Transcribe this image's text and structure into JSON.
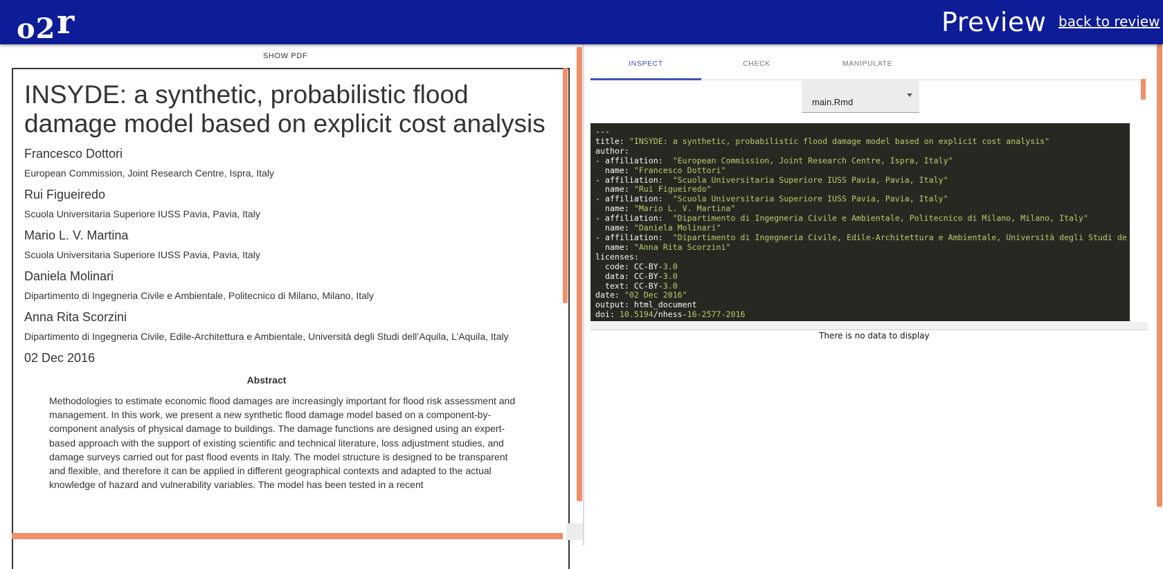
{
  "header": {
    "logo_text_o2": "o2",
    "logo_text_r": "r",
    "preview_title": "Preview",
    "back_link": "back to review"
  },
  "left": {
    "show_pdf": "SHOW PDF",
    "title": "INSYDE: a synthetic, probabilistic flood damage model based on explicit cost analysis",
    "authors": [
      {
        "name": "Francesco Dottori",
        "affiliation": "European Commission, Joint Research Centre, Ispra, Italy"
      },
      {
        "name": "Rui Figueiredo",
        "affiliation": "Scuola Universitaria Superiore IUSS Pavia, Pavia, Italy"
      },
      {
        "name": "Mario L. V. Martina",
        "affiliation": "Scuola Universitaria Superiore IUSS Pavia, Pavia, Italy"
      },
      {
        "name": "Daniela Molinari",
        "affiliation": "Dipartimento di Ingegneria Civile e Ambientale, Politecnico di Milano, Milano, Italy"
      },
      {
        "name": "Anna Rita Scorzini",
        "affiliation": "Dipartimento di Ingegneria Civile, Edile-Architettura e Ambientale, Università degli Studi dell’Aquila, L’Aquila, Italy"
      }
    ],
    "date": "02 Dec 2016",
    "abstract_title": "Abstract",
    "abstract_text": "Methodologies to estimate economic flood damages are increasingly important for flood risk assessment and management. In this work, we present a new synthetic flood damage model based on a component-by-component analysis of physical damage to buildings. The damage functions are designed using an expert-based approach with the support of existing scientific and technical literature, loss adjustment studies, and damage surveys carried out for past flood events in Italy. The model structure is designed to be transparent and flexible, and therefore it can be applied in different geographical contexts and adapted to the actual knowledge of hazard and vulnerability variables.  The model has been tested in a recent"
  },
  "right": {
    "tabs": [
      {
        "label": "INSPECT",
        "active": true
      },
      {
        "label": "CHECK",
        "active": false
      },
      {
        "label": "MANIPULATE",
        "active": false
      }
    ],
    "file_select": "main.Rmd",
    "code_lines": [
      [
        {
          "t": "---",
          "c": "k"
        }
      ],
      [
        {
          "t": "title: ",
          "c": "k"
        },
        {
          "t": "\"INSYDE: a synthetic, probabilistic flood damage model based on explicit cost analysis\"",
          "c": "s"
        }
      ],
      [
        {
          "t": "author:",
          "c": "k"
        }
      ],
      [
        {
          "t": "- affiliation:  ",
          "c": "k"
        },
        {
          "t": "\"European Commission, Joint Research Centre, Ispra, Italy\"",
          "c": "s"
        }
      ],
      [
        {
          "t": "  name: ",
          "c": "k"
        },
        {
          "t": "\"Francesco Dottori\"",
          "c": "s"
        }
      ],
      [
        {
          "t": "- affiliation:  ",
          "c": "k"
        },
        {
          "t": "\"Scuola Universitaria Superiore IUSS Pavia, Pavia, Italy\"",
          "c": "s"
        }
      ],
      [
        {
          "t": "  name: ",
          "c": "k"
        },
        {
          "t": "\"Rui Figueiredo\"",
          "c": "s"
        }
      ],
      [
        {
          "t": "- affiliation:  ",
          "c": "k"
        },
        {
          "t": "\"Scuola Universitaria Superiore IUSS Pavia, Pavia, Italy\"",
          "c": "s"
        }
      ],
      [
        {
          "t": "  name: ",
          "c": "k"
        },
        {
          "t": "\"Mario L. V. Martina\"",
          "c": "s"
        }
      ],
      [
        {
          "t": "- affiliation:  ",
          "c": "k"
        },
        {
          "t": "\"Dipartimento di Ingegneria Civile e Ambientale, Politecnico di Milano, Milano, Italy\"",
          "c": "s"
        }
      ],
      [
        {
          "t": "  name: ",
          "c": "k"
        },
        {
          "t": "\"Daniela Molinari\"",
          "c": "s"
        }
      ],
      [
        {
          "t": "- affiliation:  ",
          "c": "k"
        },
        {
          "t": "\"Dipartimento di Ingegneria Civile, Edile-Architettura e Ambientale, Università degli Studi de",
          "c": "s"
        }
      ],
      [
        {
          "t": "  name: ",
          "c": "k"
        },
        {
          "t": "\"Anna Rita Scorzini\"",
          "c": "s"
        }
      ],
      [
        {
          "t": "licenses:",
          "c": "k"
        }
      ],
      [
        {
          "t": "  code: CC-BY-",
          "c": "k"
        },
        {
          "t": "3.0",
          "c": "n"
        }
      ],
      [
        {
          "t": "  data: CC-BY-",
          "c": "k"
        },
        {
          "t": "3.0",
          "c": "n"
        }
      ],
      [
        {
          "t": "  text: CC-BY-",
          "c": "k"
        },
        {
          "t": "3.0",
          "c": "n"
        }
      ],
      [
        {
          "t": "date: ",
          "c": "k"
        },
        {
          "t": "\"02 Dec 2016\"",
          "c": "s"
        }
      ],
      [
        {
          "t": "output: html_document",
          "c": "k"
        }
      ],
      [
        {
          "t": "doi: ",
          "c": "k"
        },
        {
          "t": "10.5194",
          "c": "n"
        },
        {
          "t": "/nhess-",
          "c": "k"
        },
        {
          "t": "16-2577-2016",
          "c": "n"
        }
      ]
    ],
    "no_data": "There is no data to display"
  },
  "colors": {
    "header_bg": "#0d1c97",
    "scrollbar": "#ef8f6c",
    "tab_active": "#3f51b5",
    "code_bg": "#272822",
    "code_string": "#b6cd6c"
  },
  "icons": {
    "select_caret": "caret-down-icon"
  }
}
